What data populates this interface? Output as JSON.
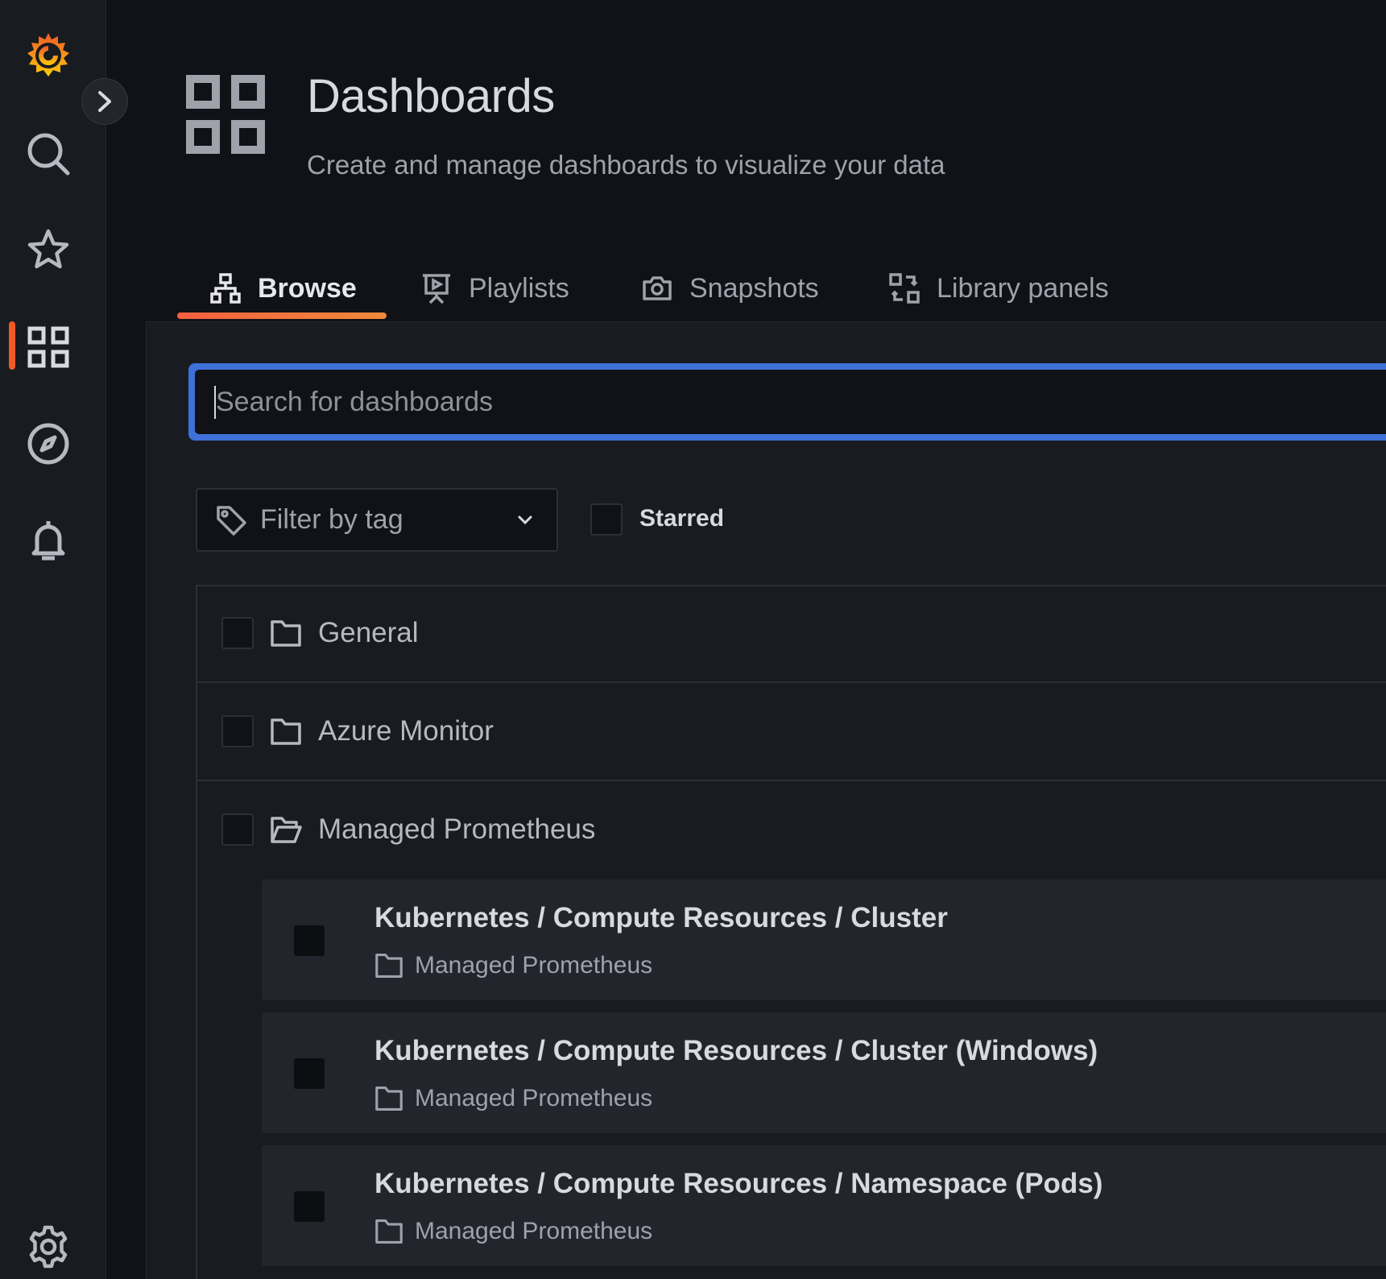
{
  "header": {
    "title": "Dashboards",
    "subtitle": "Create and manage dashboards to visualize your data"
  },
  "tabs": [
    {
      "label": "Browse",
      "icon": "sitemap-icon",
      "active": true
    },
    {
      "label": "Playlists",
      "icon": "presentation-play-icon",
      "active": false
    },
    {
      "label": "Snapshots",
      "icon": "camera-icon",
      "active": false
    },
    {
      "label": "Library panels",
      "icon": "library-panel-icon",
      "active": false
    }
  ],
  "search": {
    "placeholder": "Search for dashboards",
    "value": ""
  },
  "filters": {
    "tag_filter_label": "Filter by tag",
    "starred_label": "Starred",
    "starred_checked": false
  },
  "folders": [
    {
      "name": "General",
      "expanded": false
    },
    {
      "name": "Azure Monitor",
      "expanded": false
    },
    {
      "name": "Managed Prometheus",
      "expanded": true
    }
  ],
  "dashboards": [
    {
      "title": "Kubernetes / Compute Resources / Cluster",
      "folder": "Managed Prometheus"
    },
    {
      "title": "Kubernetes / Compute Resources / Cluster (Windows)",
      "folder": "Managed Prometheus"
    },
    {
      "title": "Kubernetes / Compute Resources / Namespace (Pods)",
      "folder": "Managed Prometheus"
    }
  ],
  "sidebar": {
    "items": [
      {
        "name": "logo",
        "icon": "grafana-logo-icon"
      },
      {
        "name": "search",
        "icon": "search-icon"
      },
      {
        "name": "starred",
        "icon": "star-icon"
      },
      {
        "name": "dashboards",
        "icon": "apps-grid-icon",
        "active": true
      },
      {
        "name": "explore",
        "icon": "compass-icon"
      },
      {
        "name": "alerting",
        "icon": "bell-icon"
      },
      {
        "name": "configuration",
        "icon": "gear-icon"
      }
    ]
  },
  "colors": {
    "background": "#111217",
    "panel": "#181b1f",
    "accent_orange": "#f05a28",
    "focus_blue": "#3d71d9"
  }
}
